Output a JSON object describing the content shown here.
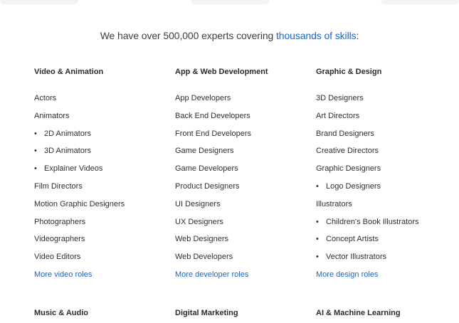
{
  "headline": {
    "prefix": "We have over 500,000 experts covering ",
    "link": "thousands of skills",
    "suffix": ":"
  },
  "columns": [
    {
      "title": "Video & Animation",
      "items": [
        {
          "label": "Actors",
          "sub": false
        },
        {
          "label": "Animators",
          "sub": false
        },
        {
          "label": "2D Animators",
          "sub": true
        },
        {
          "label": "3D Animators",
          "sub": true
        },
        {
          "label": "Explainer Videos",
          "sub": true
        },
        {
          "label": "Film Directors",
          "sub": false
        },
        {
          "label": "Motion Graphic Designers",
          "sub": false
        },
        {
          "label": "Photographers",
          "sub": false
        },
        {
          "label": "Videographers",
          "sub": false
        },
        {
          "label": "Video Editors",
          "sub": false
        }
      ],
      "more": "More video roles"
    },
    {
      "title": "App & Web Development",
      "items": [
        {
          "label": "App Developers",
          "sub": false
        },
        {
          "label": "Back End Developers",
          "sub": false
        },
        {
          "label": "Front End Developers",
          "sub": false
        },
        {
          "label": "Game Designers",
          "sub": false
        },
        {
          "label": "Game Developers",
          "sub": false
        },
        {
          "label": "Product Designers",
          "sub": false
        },
        {
          "label": "UI Designers",
          "sub": false
        },
        {
          "label": "UX Designers",
          "sub": false
        },
        {
          "label": "Web Designers",
          "sub": false
        },
        {
          "label": "Web Developers",
          "sub": false
        }
      ],
      "more": "More developer roles"
    },
    {
      "title": "Graphic & Design",
      "items": [
        {
          "label": "3D Designers",
          "sub": false
        },
        {
          "label": "Art Directors",
          "sub": false
        },
        {
          "label": "Brand Designers",
          "sub": false
        },
        {
          "label": "Creative Directors",
          "sub": false
        },
        {
          "label": "Graphic Designers",
          "sub": false
        },
        {
          "label": "Logo Designers",
          "sub": true
        },
        {
          "label": "Illustrators",
          "sub": false
        },
        {
          "label": "Children's Book Illustrators",
          "sub": true
        },
        {
          "label": "Concept Artists",
          "sub": true
        },
        {
          "label": "Vector Illustrators",
          "sub": true
        }
      ],
      "more": "More design roles"
    }
  ],
  "next_row": [
    "Music & Audio",
    "Digital Marketing",
    "AI & Machine Learning"
  ],
  "colors": {
    "link": "#1967d2",
    "text": "#2e3034"
  },
  "bullet": "•"
}
